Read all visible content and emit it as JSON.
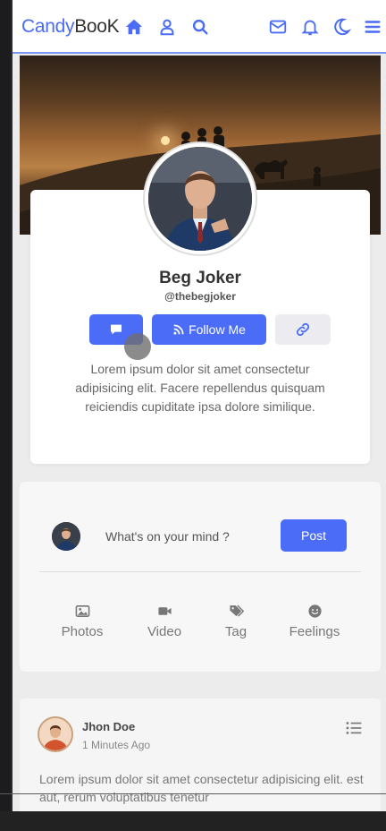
{
  "navbar": {
    "brand_part1": "Candy",
    "brand_part2": "BooK",
    "icons": [
      "home-icon",
      "user-icon",
      "search-icon",
      "mail-icon",
      "bell-icon",
      "moon-icon",
      "menu-icon"
    ]
  },
  "profile": {
    "name": "Beg Joker",
    "handle": "@thebegjoker",
    "follow_label": "Follow Me",
    "bio": "Lorem ipsum dolor sit amet consectetur adipisicing elit. Facere repellendus quisquam reiciendis cupiditate ipsa dolore similique."
  },
  "composer": {
    "prompt": "What's on your mind ?",
    "post_label": "Post",
    "actions": [
      {
        "label": "Photos",
        "icon": "image-icon"
      },
      {
        "label": "Video",
        "icon": "video-icon"
      },
      {
        "label": "Tag",
        "icon": "tag-icon"
      },
      {
        "label": "Feelings",
        "icon": "smile-icon"
      }
    ]
  },
  "feed": {
    "post": {
      "author": "Jhon Doe",
      "time": "1 Minutes Ago",
      "text": "Lorem ipsum dolor sit amet consectetur adipisicing elit. est aut, rerum voluptatibus tenetur"
    }
  },
  "colors": {
    "accent": "#4a6cf7",
    "background": "#ececec",
    "text": "#333333"
  }
}
